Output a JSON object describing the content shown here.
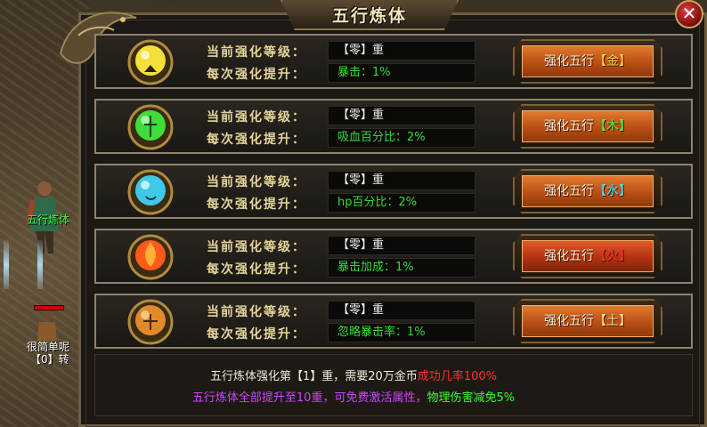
{
  "title": "五行炼体",
  "close_label": "✕",
  "labels": {
    "current_level": "当前强化等级：",
    "per_upgrade": "每次强化提升："
  },
  "rows": [
    {
      "element": "金",
      "level": "【零】重",
      "bonus": "暴击：1%",
      "button_prefix": "强化五行",
      "button_element": "【金】",
      "orb_color": "#f3e03a",
      "element_text_color": "#ffd84a"
    },
    {
      "element": "木",
      "level": "【零】重",
      "bonus": "吸血百分比：2%",
      "button_prefix": "强化五行",
      "button_element": "【木】",
      "orb_color": "#3fdc3a",
      "element_text_color": "#44ff44"
    },
    {
      "element": "水",
      "level": "【零】重",
      "bonus": "hp百分比：2%",
      "button_prefix": "强化五行",
      "button_element": "【水】",
      "orb_color": "#3fc8e8",
      "element_text_color": "#44e4ff"
    },
    {
      "element": "火",
      "level": "【零】重",
      "bonus": "暴击加成：1%",
      "button_prefix": "强化五行",
      "button_element": "【火】",
      "orb_color": "#ff5a1a",
      "element_text_color": "#ff3030"
    },
    {
      "element": "土",
      "level": "【零】重",
      "bonus": "忽略暴击率：1%",
      "button_prefix": "强化五行",
      "button_element": "【土】",
      "orb_color": "#e08a2a",
      "element_text_color": "#ffe9a6"
    }
  ],
  "footer": {
    "line1_main": "五行炼体强化第【1】重，需要20万金币",
    "line1_rate": "成功几率100%",
    "line2_main": "五行炼体全部提升至10重，可免费激活属性，",
    "line2_effect": "物理伤害减免5%"
  },
  "scene": {
    "npc_name": "五行炼体",
    "player_name": "很简单呢",
    "player_rebirth": "【0】转"
  },
  "colors": {
    "panel_bg": "#1c1914",
    "label_gold": "#e6d59a",
    "value_green": "#33dd33",
    "button_orange": "#c55a18",
    "rate_red": "#ff3030",
    "footer_purple": "#cc44ff"
  }
}
